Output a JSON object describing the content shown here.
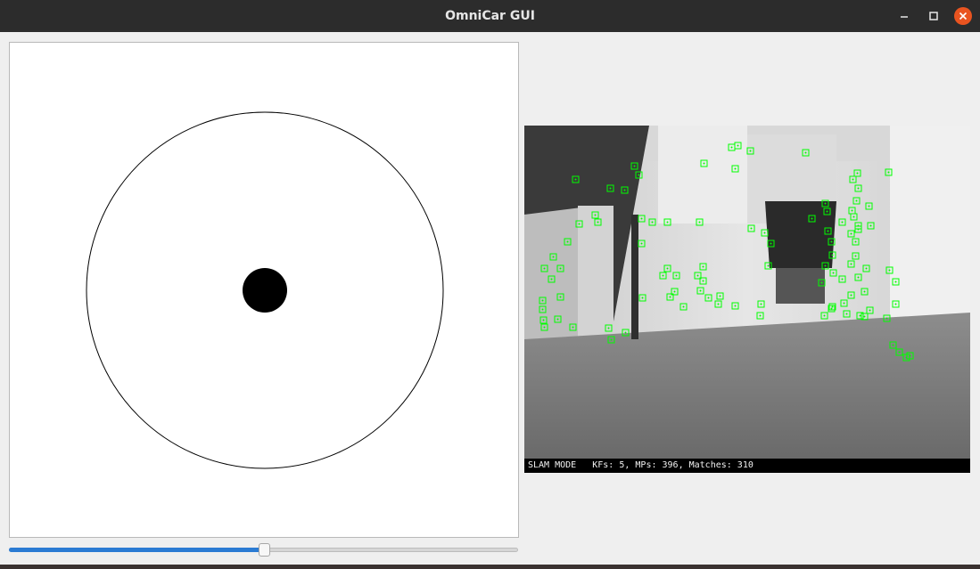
{
  "window": {
    "title": "OmniCar GUI",
    "controls": {
      "minimize": "minimize-icon",
      "maximize": "maximize-icon",
      "close": "close-icon"
    },
    "colors": {
      "titlebar": "#2c2c2c",
      "close": "#e95420",
      "background": "#efefef"
    }
  },
  "joystick": {
    "pad_color": "#ffffff",
    "knob_color": "#000000"
  },
  "speed_slider": {
    "value_fraction": 0.5,
    "fill_color": "#2b7bd3"
  },
  "camera_view": {
    "status_text": "SLAM MODE   KFs: 5, MPs: 396, Matches: 310",
    "feature_color": "#00ff00"
  }
}
